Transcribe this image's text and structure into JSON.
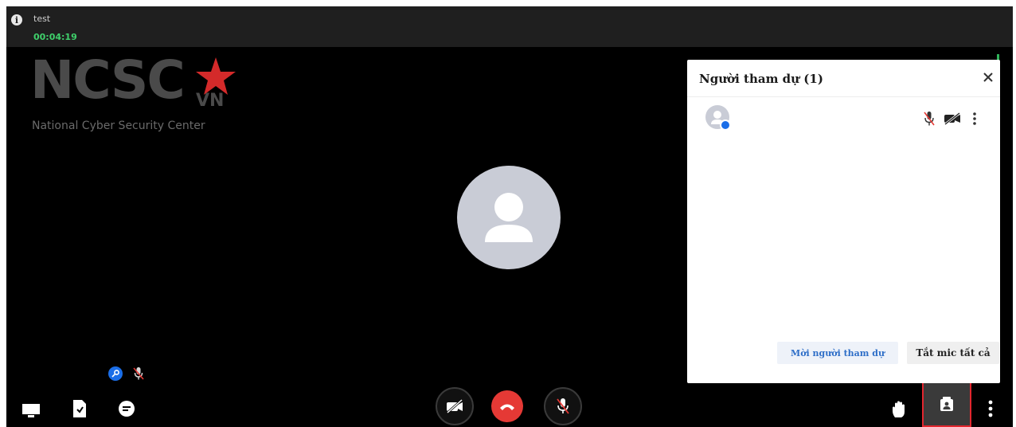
{
  "meeting": {
    "title": "test",
    "timer": "00:04:19"
  },
  "logo": {
    "main_text": "NCSC",
    "suffix": "VN",
    "subtitle": "National Cyber Security Center"
  },
  "icons": {
    "info": "info-icon",
    "star": "star-icon",
    "avatar": "user-avatar-icon",
    "key": "key-icon",
    "mic_off": "mic-off-icon",
    "cam_off": "camera-off-icon",
    "end_call": "phone-hangup-icon",
    "screen_share": "screen-share-icon",
    "document": "document-icon",
    "chat": "chat-icon",
    "raise_hand": "hand-icon",
    "participants": "participants-icon",
    "more": "more-vertical-icon",
    "close": "close-icon"
  },
  "participants_panel": {
    "title": "Người tham dự (1)",
    "invite_label": "Mời người tham dự",
    "mute_all_label": "Tắt mic tất cả",
    "participants": [
      {
        "name": ""
      }
    ]
  },
  "colors": {
    "stage_background": "#000000",
    "topbar_background": "#1f1f1f",
    "timer_green": "#3fd06b",
    "end_call_red": "#e53935",
    "highlight_red": "#e2262e",
    "accent_blue": "#1b6ee8",
    "invite_text_blue": "#2f6fc8"
  }
}
